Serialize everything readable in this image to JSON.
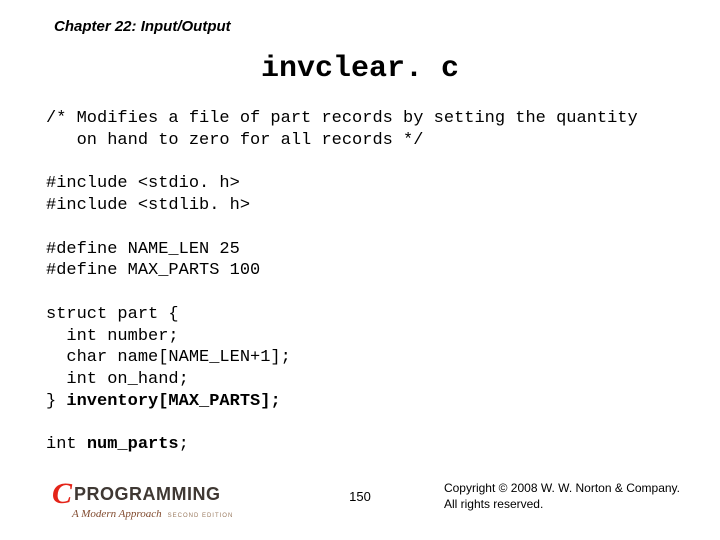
{
  "chapter": "Chapter 22: Input/Output",
  "title": "invclear. c",
  "code": {
    "l01": "/* Modifies a file of part records by setting the quantity",
    "l02": "   on hand to zero for all records */",
    "l03": "",
    "l04": "#include <stdio. h>",
    "l05": "#include <stdlib. h>",
    "l06": "",
    "l07": "#define NAME_LEN 25",
    "l08": "#define MAX_PARTS 100",
    "l09": "",
    "l10": "struct part {",
    "l11": "  int number;",
    "l12": "  char name[NAME_LEN+1];",
    "l13": "  int on_hand;",
    "l14a": "} ",
    "l14b": "inventory[MAX_PARTS];",
    "l15": "",
    "l16a": "int ",
    "l16b": "num_parts",
    "l16c": ";"
  },
  "logo": {
    "c": "C",
    "prog": "PROGRAMMING",
    "sub": "A Modern Approach",
    "ed": "SECOND EDITION"
  },
  "pagenum": "150",
  "copyright_l1": "Copyright © 2008 W. W. Norton & Company.",
  "copyright_l2": "All rights reserved."
}
